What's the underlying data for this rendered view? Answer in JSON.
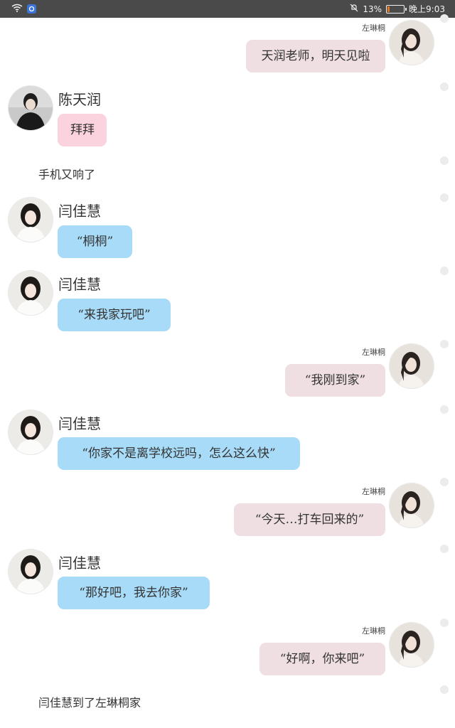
{
  "status_bar": {
    "battery_percent_text": "13%",
    "time": "晚上9:03",
    "battery_level": 0.13,
    "icons": [
      "wifi-icon",
      "app-badge-icon",
      "mute-icon",
      "battery-icon"
    ],
    "battery_color": "#e2761a"
  },
  "colors": {
    "self_bubble": "#efdfe2",
    "friend_bubble": "#a8dbf7",
    "teacher_bubble": "#fad3de"
  },
  "messages": [
    {
      "type": "self",
      "name": "左琳桐",
      "text": "天润老师，明天见啦"
    },
    {
      "type": "other",
      "name": "陈天润",
      "text": "拜拜"
    },
    {
      "type": "narration",
      "text": "手机又响了"
    },
    {
      "type": "other",
      "name": "闫佳慧",
      "text": "“桐桐”"
    },
    {
      "type": "other",
      "name": "闫佳慧",
      "text": "“来我家玩吧”"
    },
    {
      "type": "self",
      "name": "左琳桐",
      "text": "“我刚到家”"
    },
    {
      "type": "other",
      "name": "闫佳慧",
      "text": "“你家不是离学校远吗，怎么这么快”"
    },
    {
      "type": "self",
      "name": "左琳桐",
      "text": "“今天…打车回来的”"
    },
    {
      "type": "other",
      "name": "闫佳慧",
      "text": "“那好吧，我去你家”"
    },
    {
      "type": "self",
      "name": "左琳桐",
      "text": "“好啊，你来吧”"
    },
    {
      "type": "narration",
      "text": "闫佳慧到了左琳桐家"
    }
  ]
}
